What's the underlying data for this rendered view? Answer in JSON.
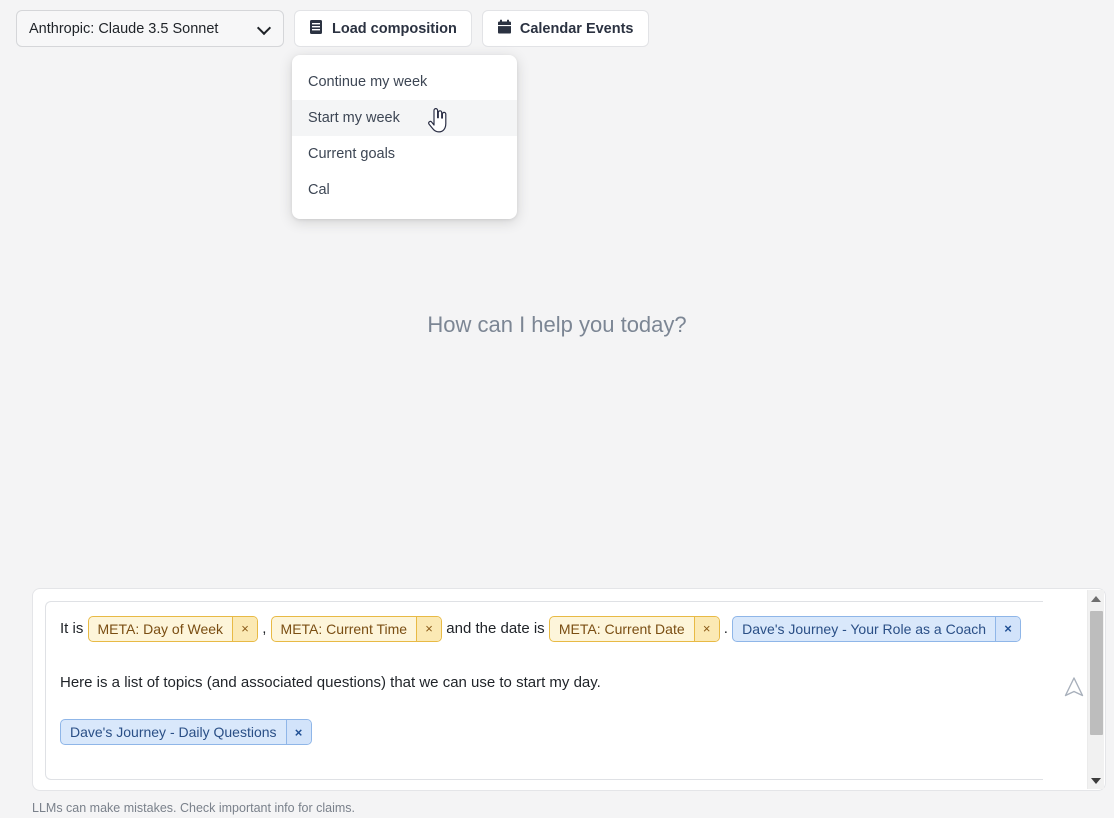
{
  "toolbar": {
    "model_select": {
      "value": "Anthropic: Claude 3.5 Sonnet",
      "chevron_icon": "chevron-down-icon"
    },
    "load_composition": {
      "label": "Load composition",
      "icon": "book-icon"
    },
    "calendar_events": {
      "label": "Calendar Events",
      "icon": "calendar-icon"
    }
  },
  "menu": {
    "items": [
      {
        "label": "Continue my week",
        "active": false
      },
      {
        "label": "Start my week",
        "active": true
      },
      {
        "label": "Current goals",
        "active": false
      },
      {
        "label": "Cal",
        "active": false
      }
    ]
  },
  "main": {
    "placeholder_heading": "How can I help you today?"
  },
  "composer": {
    "line1": {
      "prefix": "It is ",
      "separator1": " , ",
      "middle": " and the date is ",
      "separator2": " . ",
      "tags": [
        {
          "label": "META: Day of Week",
          "kind": "meta",
          "close": "×"
        },
        {
          "label": "META: Current Time",
          "kind": "meta",
          "close": "×"
        },
        {
          "label": "META: Current Date",
          "kind": "meta",
          "close": "×"
        },
        {
          "label": "Dave's Journey - Your Role as a Coach",
          "kind": "blue",
          "close": "×"
        }
      ]
    },
    "paragraph": "Here is a list of topics (and associated questions) that we can use to start my day.",
    "tag_row": [
      {
        "label": "Dave's Journey - Daily Questions",
        "kind": "blue",
        "close": "×"
      }
    ],
    "send_icon": "send-icon",
    "scrollbar": {
      "up_icon": "scroll-up-arrow-icon",
      "down_icon": "scroll-down-arrow-icon"
    }
  },
  "footer": {
    "disclaimer": "LLMs can make mistakes. Check important info for claims."
  },
  "cursor": {
    "type": "pointer-hand-cursor"
  },
  "colors": {
    "page_bg": "#f4f4f5",
    "meta_tag_bg": "#fdf5da",
    "meta_tag_border": "#e8ba45",
    "meta_tag_text": "#7a4e13",
    "blue_tag_bg": "#d9e8fb",
    "blue_tag_border": "#8fb6e8",
    "blue_tag_text": "#2a4f86",
    "menu_active_bg": "#f4f5f6",
    "hint_text": "#7c8694"
  }
}
